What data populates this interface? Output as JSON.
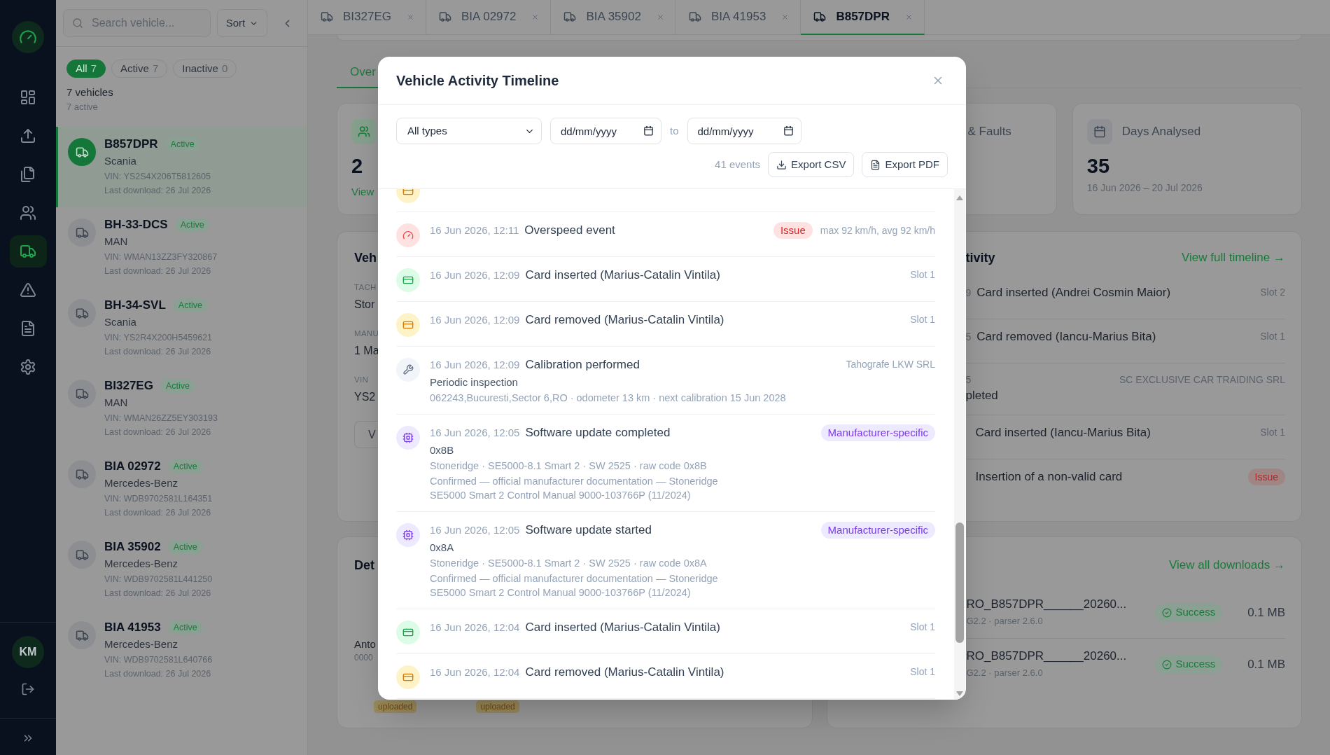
{
  "rail": {
    "nav": [
      {
        "kind": "dashboard",
        "selected": false
      },
      {
        "kind": "upload",
        "selected": false
      },
      {
        "kind": "documents",
        "selected": false
      },
      {
        "kind": "users",
        "selected": false
      },
      {
        "kind": "vehicles",
        "selected": true
      },
      {
        "kind": "alerts",
        "selected": false
      },
      {
        "kind": "reports",
        "selected": false
      },
      {
        "kind": "settings",
        "selected": false
      }
    ],
    "user": {
      "initials": "KM"
    }
  },
  "vehicle_panel": {
    "search": {
      "placeholder": "Search vehicle..."
    },
    "sort": "Sort",
    "filters": [
      {
        "label": "All",
        "count": "7",
        "selected": true
      },
      {
        "label": "Active",
        "count": "7",
        "selected": false
      },
      {
        "label": "Inactive",
        "count": "0",
        "selected": false
      }
    ],
    "summary": {
      "title": "7 vehicles",
      "subtitle": "7 active"
    },
    "vehicles": [
      {
        "plate": "B857DPR",
        "status": "Active",
        "brand": "Scania",
        "vin": "VIN: YS2S4X206T5812605",
        "last_download": "Last download: 26 Jul 2026",
        "selected": true
      },
      {
        "plate": "BH-33-DCS",
        "status": "Active",
        "brand": "MAN",
        "vin": "VIN: WMAN13ZZ3FY320867",
        "last_download": "Last download: 26 Jul 2026",
        "selected": false
      },
      {
        "plate": "BH-34-SVL",
        "status": "Active",
        "brand": "Scania",
        "vin": "VIN: YS2R4X200H5459621",
        "last_download": "Last download: 26 Jul 2026",
        "selected": false
      },
      {
        "plate": "BI327EG",
        "status": "Active",
        "brand": "MAN",
        "vin": "VIN: WMAN26ZZ5EY303193",
        "last_download": "Last download: 26 Jul 2026",
        "selected": false
      },
      {
        "plate": "BIA 02972",
        "status": "Active",
        "brand": "Mercedes-Benz",
        "vin": "VIN: WDB9702581L164351",
        "last_download": "Last download: 26 Jul 2026",
        "selected": false
      },
      {
        "plate": "BIA 35902",
        "status": "Active",
        "brand": "Mercedes-Benz",
        "vin": "VIN: WDB9702581L441250",
        "last_download": "Last download: 26 Jul 2026",
        "selected": false
      },
      {
        "plate": "BIA 41953",
        "status": "Active",
        "brand": "Mercedes-Benz",
        "vin": "VIN: WDB9702581L640766",
        "last_download": "Last download: 26 Jul 2026",
        "selected": false
      }
    ]
  },
  "tabs": [
    {
      "label": "BI327EG",
      "selected": false
    },
    {
      "label": "BIA 02972",
      "selected": false
    },
    {
      "label": "BIA 35902",
      "selected": false
    },
    {
      "label": "BIA 41953",
      "selected": false
    },
    {
      "label": "B857DPR",
      "selected": true
    }
  ],
  "overview": {
    "section_tabs": [
      {
        "label": "Over",
        "selected": true
      }
    ],
    "stats": [
      {
        "kind": "drivers",
        "value": "2",
        "link": "View"
      },
      {
        "kind": "faults",
        "label": "& Faults"
      },
      {
        "kind": "days",
        "label": "Days Analysed",
        "value": "35",
        "subtitle": "16 Jun 2026 – 20 Jul 2026"
      }
    ],
    "vehicle_card": {
      "title": "Veh",
      "fields": [
        {
          "label": "TACH",
          "value": "Stor"
        },
        {
          "label": "MANU",
          "value": "1 Ma"
        },
        {
          "label": "VIN",
          "value": "YS2"
        }
      ],
      "button": "V"
    },
    "activity_card": {
      "title": "tivity",
      "link": "View full timeline →",
      "rows": [
        {
          "kind": "inline",
          "time": "9",
          "text": "Card inserted (Andrei Cosmin Maior)",
          "meta": "Slot 2"
        },
        {
          "kind": "inline",
          "time": "5",
          "text": "Card removed (Iancu-Marius Bita)",
          "meta": "Slot 1"
        },
        {
          "kind": "stacked",
          "time": "5",
          "text": "pleted",
          "meta": "SC EXCLUSIVE CAR TRAIDING SRL"
        },
        {
          "kind": "inline",
          "text": "Card inserted (Iancu-Marius Bita)",
          "meta": "Slot 1"
        },
        {
          "kind": "inline",
          "text": "Insertion of a non-valid card",
          "badge": {
            "kind": "issue",
            "text": "Issue"
          }
        }
      ]
    },
    "details_card": {
      "title": "Det",
      "driver": {
        "name": "Anto",
        "card": "0000"
      },
      "badges": [
        "uploaded",
        "uploaded"
      ]
    },
    "downloads_card": {
      "link": "View all downloads →",
      "rows": [
        {
          "file": "RO_B857DPR______20260...",
          "subtitle": "G2.2 · parser 2.6.0",
          "status": "Success",
          "size": "0.1 MB"
        },
        {
          "file": "RO_B857DPR______20260...",
          "subtitle": "G2.2 · parser 2.6.0",
          "status": "Success",
          "size": "0.1 MB"
        }
      ]
    }
  },
  "modal": {
    "title": "Vehicle Activity Timeline",
    "filters": {
      "type": "All types",
      "date_from": {
        "placeholder": "dd/mm/yyyy"
      },
      "separator": "to",
      "date_to": {
        "placeholder": "dd/mm/yyyy"
      }
    },
    "count": "41 events",
    "actions": [
      {
        "kind": "csv",
        "label": "Export CSV"
      },
      {
        "kind": "pdf",
        "label": "Export PDF"
      }
    ],
    "events": [
      {
        "kind": "card_removed"
      },
      {
        "kind": "overspeed",
        "time": "16 Jun 2026, 12:11",
        "title": "Overspeed event",
        "badge": {
          "kind": "issue",
          "text": "Issue"
        },
        "meta": "max 92 km/h, avg 92 km/h"
      },
      {
        "kind": "card_inserted",
        "time": "16 Jun 2026, 12:09",
        "title": "Card inserted (Marius-Catalin Vintila)",
        "meta": "Slot 1"
      },
      {
        "kind": "card_removed",
        "time": "16 Jun 2026, 12:09",
        "title": "Card removed (Marius-Catalin Vintila)",
        "meta": "Slot 1"
      },
      {
        "kind": "calibration",
        "time": "16 Jun 2026, 12:09",
        "title": "Calibration performed",
        "meta": "Tahografe LKW SRL",
        "detail": "Periodic inspection",
        "specs": "062243,Bucuresti,Sector 6,RO · odometer 13 km · next calibration 15 Jun 2028"
      },
      {
        "kind": "software",
        "time": "16 Jun 2026, 12:05",
        "title": "Software update completed",
        "badge": {
          "kind": "manufacturer",
          "text": "Manufacturer-specific"
        },
        "detail": "0x8B",
        "specs": "Stoneridge · SE5000-8.1 Smart 2 · SW 2525 · raw code 0x8B",
        "source": [
          "Confirmed — official manufacturer documentation — Stoneridge",
          "SE5000 Smart 2 Control Manual 9000-103766P (11/2024)"
        ]
      },
      {
        "kind": "software",
        "time": "16 Jun 2026, 12:05",
        "title": "Software update started",
        "badge": {
          "kind": "manufacturer",
          "text": "Manufacturer-specific"
        },
        "detail": "0x8A",
        "specs": "Stoneridge · SE5000-8.1 Smart 2 · SW 2525 · raw code 0x8A",
        "source": [
          "Confirmed — official manufacturer documentation — Stoneridge",
          "SE5000 Smart 2 Control Manual 9000-103766P (11/2024)"
        ]
      },
      {
        "kind": "card_inserted",
        "time": "16 Jun 2026, 12:04",
        "title": "Card inserted (Marius-Catalin Vintila)",
        "meta": "Slot 1"
      },
      {
        "kind": "card_removed",
        "time": "16 Jun 2026, 12:04",
        "title": "Card removed (Marius-Catalin Vintila)",
        "meta": "Slot 1"
      }
    ]
  }
}
